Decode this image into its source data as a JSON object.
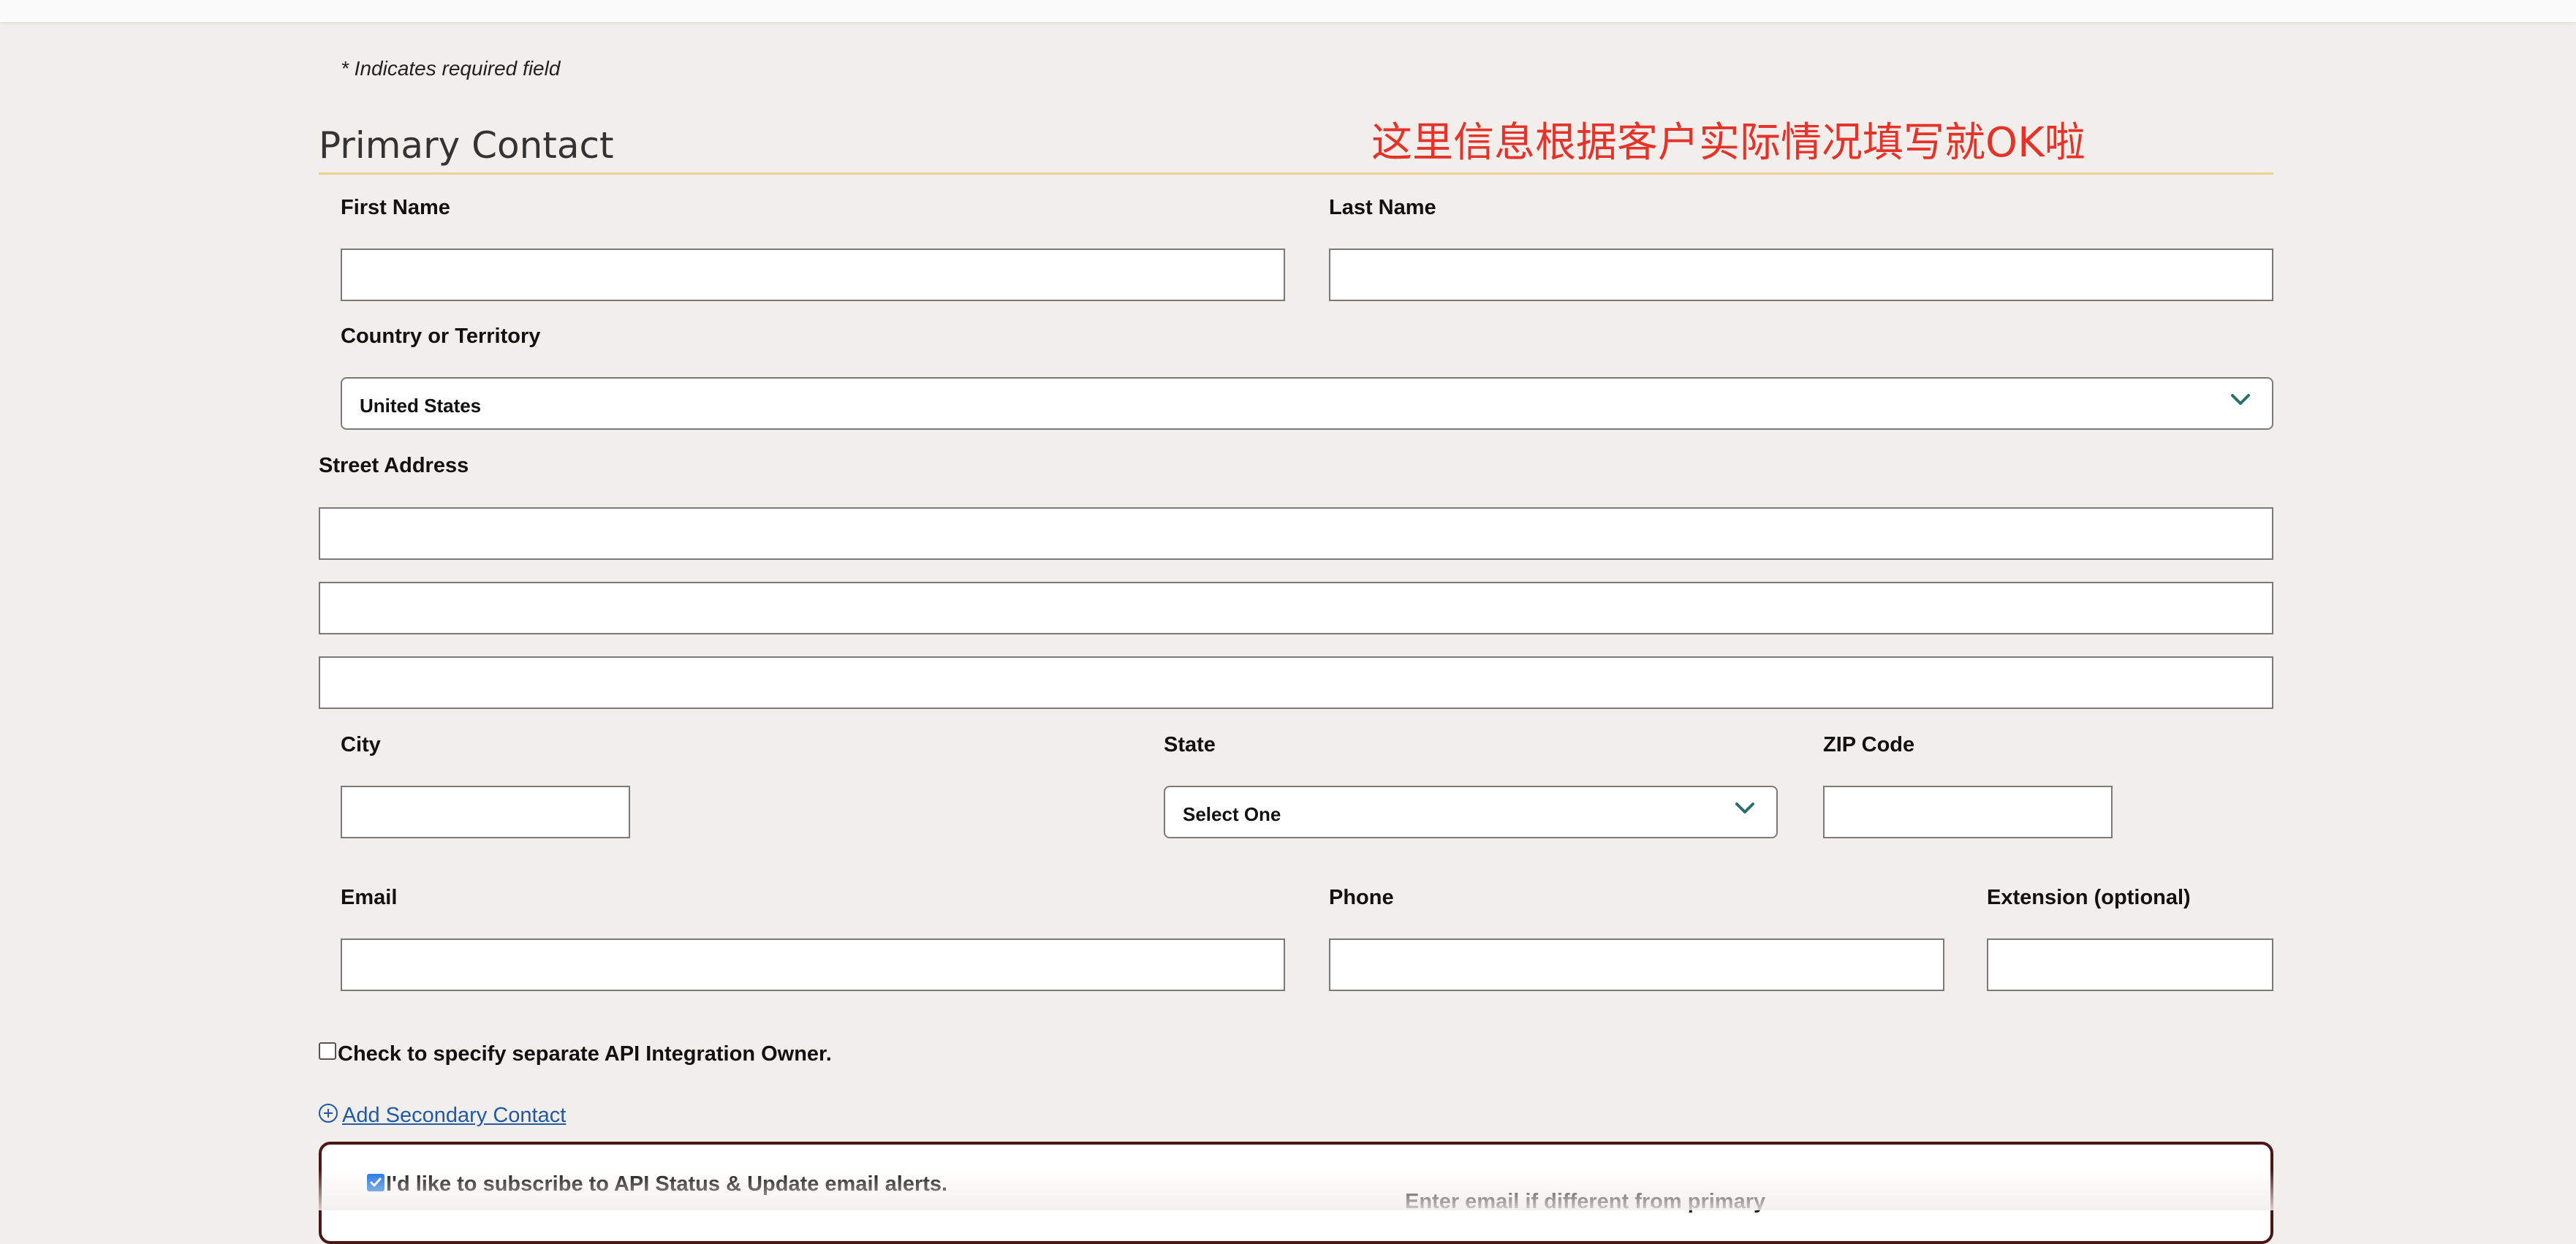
{
  "form": {
    "required_note": "* Indicates required field",
    "section_title": "Primary Contact",
    "annotation": "这里信息根据客户实际情况填写就OK啦",
    "fields": {
      "first_name": {
        "label": "First Name",
        "value": ""
      },
      "last_name": {
        "label": "Last Name",
        "value": ""
      },
      "country": {
        "label": "Country or Territory",
        "value": "United States"
      },
      "street_address": {
        "label": "Street Address",
        "line1": "",
        "line2": "",
        "line3": ""
      },
      "city": {
        "label": "City",
        "value": ""
      },
      "state": {
        "label": "State",
        "value": "Select One"
      },
      "zip": {
        "label": "ZIP Code",
        "value": ""
      },
      "email": {
        "label": "Email",
        "value": ""
      },
      "phone": {
        "label": "Phone",
        "value": ""
      },
      "extension": {
        "label": "Extension (optional)",
        "value": ""
      }
    },
    "api_owner_checkbox": {
      "label": "Check to specify separate API Integration Owner.",
      "checked": false
    },
    "add_secondary_contact": "Add Secondary Contact",
    "alerts": {
      "subscribe_label": "I'd like to subscribe to API Status & Update email alerts.",
      "subscribe_checked": true,
      "alt_email_label": "Enter email if different from primary"
    }
  },
  "colors": {
    "background": "#f1eeeb",
    "accent_rule": "#ecd28e",
    "annotation": "#e5332a",
    "link": "#1f59a8",
    "chevron": "#2a6f6b",
    "alert_border": "#4a1616"
  },
  "icons": {
    "dropdown": "chevron-down-icon",
    "add": "plus-circle-icon",
    "check": "checkmark-icon"
  }
}
